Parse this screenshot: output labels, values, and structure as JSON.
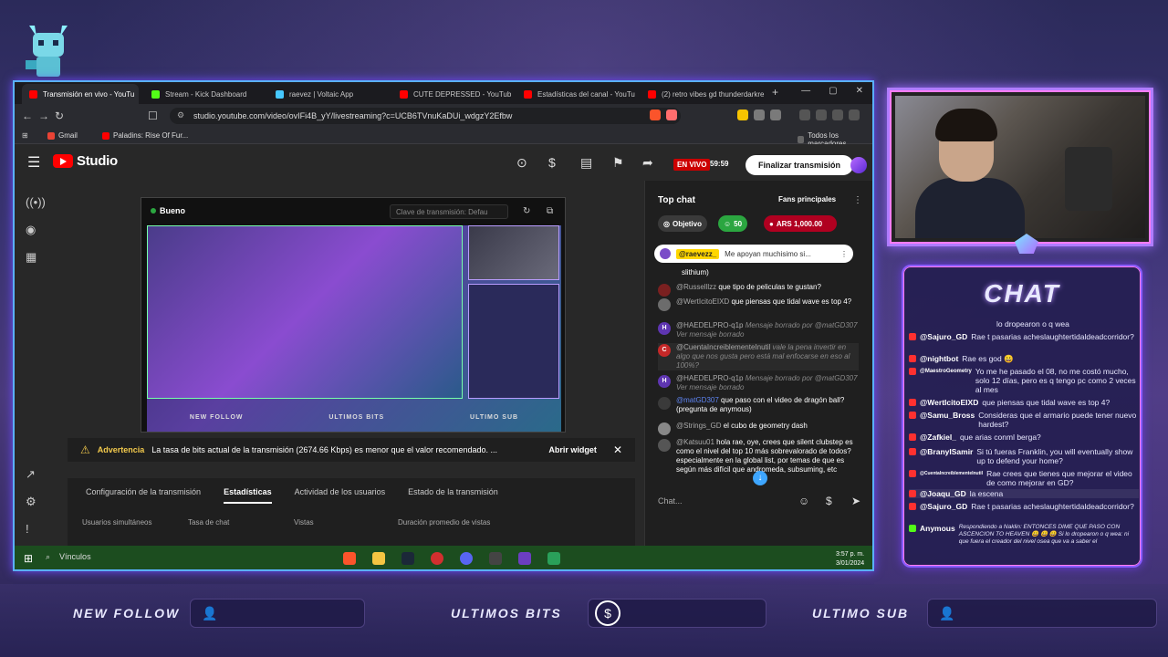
{
  "browser": {
    "tabs": [
      {
        "label": "Transmisión en vivo - YouTu",
        "active": true
      },
      {
        "label": "Stream - Kick Dashboard"
      },
      {
        "label": "raevez | Voltaic App"
      },
      {
        "label": "CUTE DEPRESSED - YouTube"
      },
      {
        "label": "Estadísticas del canal - YouTub"
      },
      {
        "label": "(2) retro vibes gd thunderdarkre"
      }
    ],
    "url": "studio.youtube.com/video/ovIFi4B_yY/livestreaming?c=UCB6TVnuKaDUi_wdgzY2Efbw",
    "bookmarks": [
      {
        "label": "Gmail"
      },
      {
        "label": "Paladins: Rise Of Fur..."
      }
    ],
    "all_bookmarks": "Todos los marcadores"
  },
  "studio": {
    "logo": "Studio",
    "live_badge": "EN VIVO",
    "live_time": "59:59",
    "end_button": "Finalizar transmisión",
    "preview": {
      "status": "Bueno",
      "stream_key": "Clave de transmisión: Defau",
      "bar_labels": [
        "NEW FOLLOW",
        "ULTIMOS BITS",
        "ULTIMO SUB"
      ]
    },
    "warning": {
      "title": "Advertencia",
      "message": "La tasa de bits actual de la transmisión (2674.66 Kbps) es menor que el valor recomendado. ...",
      "action": "Abrir widget"
    },
    "tabs": [
      "Configuración de la transmisión",
      "Estadísticas",
      "Actividad de los usuarios",
      "Estado de la transmisión"
    ],
    "stats": [
      "Usuarios simultáneos",
      "Tasa de chat",
      "Vistas",
      "Duración promedio de vistas"
    ]
  },
  "chat": {
    "title": "Top chat",
    "fans": "Fans principales",
    "chips": {
      "goal": "Objetivo",
      "count": "50",
      "amount": "ARS 1,000.00"
    },
    "pinned": {
      "user": "@raevezz_",
      "text": "Me apoyan muchisimo si..."
    },
    "partial": "slithium)",
    "messages": [
      {
        "user": "@Russelllzz",
        "text": "que tipo de peliculas te gustan?"
      },
      {
        "user": "@WertIcitoEIXD",
        "text": "que piensas que tidal wave es top 4?"
      },
      {
        "user": "@HAEDELPRO-q1p",
        "text": "Mensaje borrado por @matGD307 Ver mensaje borrado"
      },
      {
        "user": "@CuentaIncreiblementeInutil",
        "text": "vale la pena invertir en algo que nos gusta pero está mal enfocarse en eso al 100%?"
      },
      {
        "user": "@HAEDELPRO-q1p",
        "text": "Mensaje borrado por @matGD307 Ver mensaje borrado"
      },
      {
        "user": "@matGD307",
        "text": "que paso con el video de dragón ball? (pregunta de anymous)"
      },
      {
        "user": "@Strings_GD",
        "text": "el cubo de geometry dash"
      },
      {
        "user": "@Katsuu01",
        "text": "hola rae, oye, crees que silent clubstep es como el nivel del top 10 más sobrevalorado de todos? especialmente en la global list, por temas de que es según más difícil que andromeda, subsuming, etc"
      }
    ],
    "input_placeholder": "Chat..."
  },
  "taskbar": {
    "search": "Vínculos",
    "time": "3:57 p. m.",
    "date": "3/01/2024"
  },
  "overlay_chat": {
    "title": "CHAT",
    "messages": [
      {
        "user": "",
        "text": "lo dropearon o q wea"
      },
      {
        "user": "@Sajuro_GD",
        "text": "Rae t pasarias acheslaughtertidaldeadcorridor?"
      },
      {
        "user": "@nightbot",
        "text": "Rae es god 😀"
      },
      {
        "user": "@MaestroGeometry",
        "text": "Yo me he pasado el 08, no me costó mucho, solo 12 días, pero es q tengo pc como 2 veces al mes"
      },
      {
        "user": "@WertIcitoEIXD",
        "text": "que piensas que tidal wave es top 4?"
      },
      {
        "user": "@Samu_Bross",
        "text": "Consideras que el armario puede tener nuevo hardest?"
      },
      {
        "user": "@Zafkiel_",
        "text": "que arias conml berga?"
      },
      {
        "user": "@BranyISamir",
        "text": "Si tú fueras Franklin, you will eventually show up to defend your home?"
      },
      {
        "user": "@CuentaIncreiblementeInutil",
        "text": "Rae crees que tienes que mejorar el video de como mejorar en GD?"
      },
      {
        "user": "@Joaqu_GD",
        "text": "la escena"
      },
      {
        "user": "@Sajuro_GD",
        "text": "Rae t pasarias acheslaughtertidaldeadcorridor?"
      },
      {
        "user": "Anymous",
        "text": "Respondiendo a Naklin: ENTONCES DIME QUE PASO CON ASCENCION TO HEAVEN 😀 😀 😀 Si lo dropearon o q wea: ni que fuera el creador del nivel osea que va a saber el"
      }
    ]
  },
  "bottom_bar": {
    "new_follow": "NEW FOLLOW",
    "ultimos_bits": "ULTIMOS BITS",
    "ultimo_sub": "ULTIMO SUB"
  }
}
